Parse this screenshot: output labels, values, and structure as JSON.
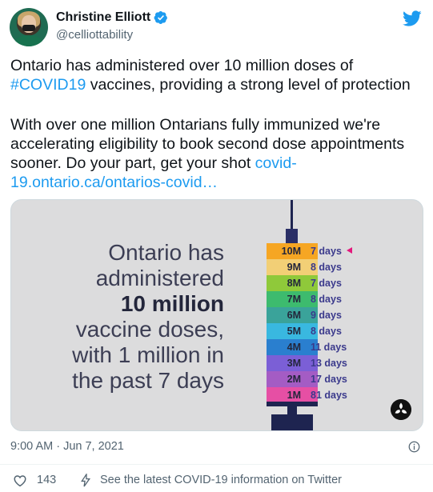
{
  "author": {
    "display_name": "Christine Elliott",
    "handle": "@celliottability",
    "verified_icon": "verified-badge-icon",
    "platform_icon": "twitter-bird-icon"
  },
  "tweet": {
    "line1": "Ontario has administered over 10 million doses of",
    "hashtag": "#COVID19",
    "line2_rest": " vaccines, providing a strong level of protection",
    "para2_text": "With over one million Ontarians fully immunized we're accelerating eligibility to book second dose appointments sooner. Do your part, get your shot ",
    "link_text": "covid-19.ontario.ca/ontarios-covid…"
  },
  "media": {
    "headline": {
      "line1": "Ontario has",
      "line2": "administered",
      "line3_bold": "10 million",
      "line4": "vaccine doses,",
      "line5": "with 1 million in",
      "line6": "the past 7 days"
    },
    "syringe_rows": [
      {
        "label": "10M",
        "days": "7 days",
        "color": "#f6a623"
      },
      {
        "label": "9M",
        "days": "8 days",
        "color": "#f2cf76"
      },
      {
        "label": "8M",
        "days": "7 days",
        "color": "#8fc93a"
      },
      {
        "label": "7M",
        "days": "8 days",
        "color": "#3dbb6e"
      },
      {
        "label": "6M",
        "days": "9 days",
        "color": "#3aa39a"
      },
      {
        "label": "5M",
        "days": "8 days",
        "color": "#39b8e0"
      },
      {
        "label": "4M",
        "days": "11 days",
        "color": "#2a7fcf"
      },
      {
        "label": "3M",
        "days": "13 days",
        "color": "#7b5fd6"
      },
      {
        "label": "2M",
        "days": "17 days",
        "color": "#a45cc4"
      },
      {
        "label": "1M",
        "days": "81 days",
        "color": "#e64fa4"
      }
    ],
    "logo_icon": "ontario-trillium-logo-icon"
  },
  "footer": {
    "timestamp": "9:00 AM · Jun 7, 2021",
    "info_icon": "info-icon",
    "like_count": "143",
    "covid_info": "See the latest COVID-19 information on Twitter"
  },
  "colors": {
    "link": "#1d9bf0",
    "text_secondary": "#536471",
    "twitter_blue": "#1d9bf0",
    "media_bg": "#dcdcdd"
  }
}
